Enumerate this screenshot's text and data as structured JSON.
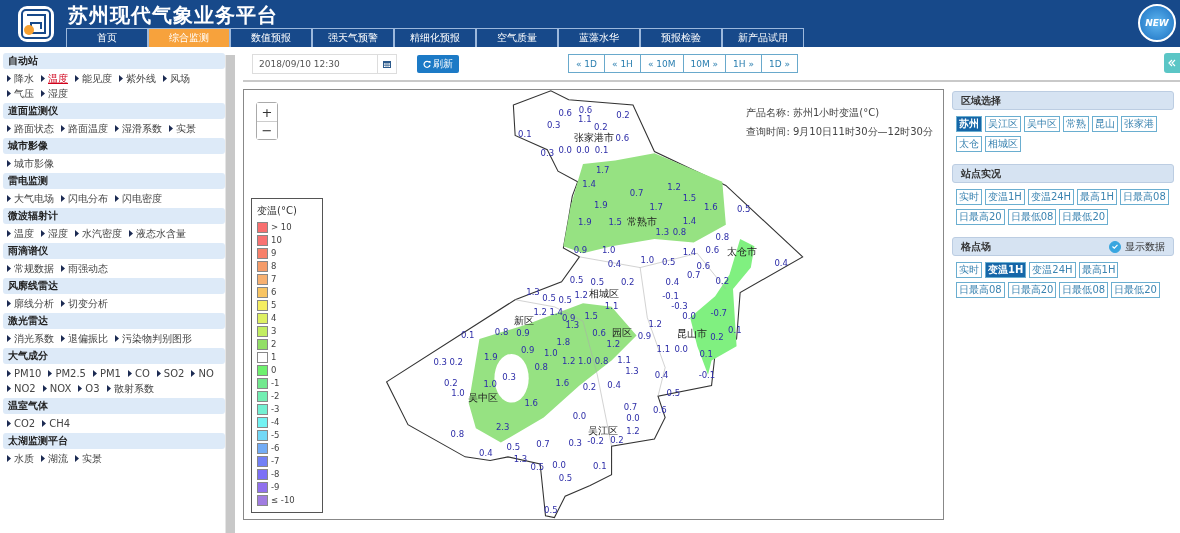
{
  "header": {
    "title": "苏州现代气象业务平台",
    "badge": "NEW"
  },
  "nav": [
    {
      "label": "首页",
      "selected": false
    },
    {
      "label": "综合监测",
      "selected": true
    },
    {
      "label": "数值预报",
      "selected": false
    },
    {
      "label": "强天气预警",
      "selected": false
    },
    {
      "label": "精细化预报",
      "selected": false
    },
    {
      "label": "空气质量",
      "selected": false
    },
    {
      "label": "蓝藻水华",
      "selected": false
    },
    {
      "label": "预报检验",
      "selected": false
    },
    {
      "label": "新产品试用",
      "selected": false
    }
  ],
  "sidebar": [
    {
      "title": "自动站",
      "items": [
        {
          "label": "降水",
          "selected": false
        },
        {
          "label": "温度",
          "selected": true
        },
        {
          "label": "能见度",
          "selected": false
        },
        {
          "label": "紫外线",
          "selected": false
        },
        {
          "label": "风场",
          "selected": false
        },
        {
          "label": "气压",
          "selected": false
        },
        {
          "label": "湿度",
          "selected": false
        }
      ]
    },
    {
      "title": "道面监测仪",
      "items": [
        {
          "label": "路面状态",
          "selected": false
        },
        {
          "label": "路面温度",
          "selected": false
        },
        {
          "label": "湿滑系数",
          "selected": false
        },
        {
          "label": "实景",
          "selected": false
        }
      ]
    },
    {
      "title": "城市影像",
      "items": [
        {
          "label": "城市影像",
          "selected": false
        }
      ]
    },
    {
      "title": "雷电监测",
      "items": [
        {
          "label": "大气电场",
          "selected": false
        },
        {
          "label": "闪电分布",
          "selected": false
        },
        {
          "label": "闪电密度",
          "selected": false
        }
      ]
    },
    {
      "title": "微波辐射计",
      "items": [
        {
          "label": "温度",
          "selected": false
        },
        {
          "label": "湿度",
          "selected": false
        },
        {
          "label": "水汽密度",
          "selected": false
        },
        {
          "label": "液态水含量",
          "selected": false
        }
      ]
    },
    {
      "title": "雨滴谱仪",
      "items": [
        {
          "label": "常规数据",
          "selected": false
        },
        {
          "label": "雨强动态",
          "selected": false
        }
      ]
    },
    {
      "title": "风廓线雷达",
      "items": [
        {
          "label": "廓线分析",
          "selected": false
        },
        {
          "label": "切变分析",
          "selected": false
        }
      ]
    },
    {
      "title": "激光雷达",
      "items": [
        {
          "label": "消光系数",
          "selected": false
        },
        {
          "label": "退偏振比",
          "selected": false
        },
        {
          "label": "污染物判别图形",
          "selected": false
        }
      ]
    },
    {
      "title": "大气成分",
      "items": [
        {
          "label": "PM10",
          "selected": false
        },
        {
          "label": "PM2.5",
          "selected": false
        },
        {
          "label": "PM1",
          "selected": false
        },
        {
          "label": "CO",
          "selected": false
        },
        {
          "label": "SO2",
          "selected": false
        },
        {
          "label": "NO",
          "selected": false
        },
        {
          "label": "NO2",
          "selected": false
        },
        {
          "label": "NOX",
          "selected": false
        },
        {
          "label": "O3",
          "selected": false
        },
        {
          "label": "散射系数",
          "selected": false
        }
      ]
    },
    {
      "title": "温室气体",
      "items": [
        {
          "label": "CO2",
          "selected": false
        },
        {
          "label": "CH4",
          "selected": false
        }
      ]
    },
    {
      "title": "太湖监测平台",
      "items": [
        {
          "label": "水质",
          "selected": false
        },
        {
          "label": "湖流",
          "selected": false
        },
        {
          "label": "实景",
          "selected": false
        }
      ]
    }
  ],
  "toolbar": {
    "datetime": "2018/09/10 12:30",
    "refresh": "刷新",
    "steps": [
      "« 1D",
      "« 1H",
      "« 10M",
      "10M »",
      "1H »",
      "1D »"
    ]
  },
  "map": {
    "product": "产品名称: 苏州1小时变温(°C)",
    "query_time": "查询时间: 9月10日11时30分—12时30分",
    "zoom_in": "+",
    "zoom_out": "−",
    "legend": {
      "title": "变温(°C)",
      "items": [
        {
          "label": "> 10",
          "color": "#f86f6f"
        },
        {
          "label": "10",
          "color": "#f87272"
        },
        {
          "label": "9",
          "color": "#f8806a"
        },
        {
          "label": "8",
          "color": "#f59c6a"
        },
        {
          "label": "7",
          "color": "#f7b070"
        },
        {
          "label": "6",
          "color": "#f8c462"
        },
        {
          "label": "5",
          "color": "#f5ee62"
        },
        {
          "label": "4",
          "color": "#def062"
        },
        {
          "label": "3",
          "color": "#c2ee62"
        },
        {
          "label": "2",
          "color": "#92de66"
        },
        {
          "label": "1",
          "color": "#ffffff"
        },
        {
          "label": "0",
          "color": "#6ef06e"
        },
        {
          "label": "-1",
          "color": "#72e88e"
        },
        {
          "label": "-2",
          "color": "#72eeb2"
        },
        {
          "label": "-3",
          "color": "#72f0d2"
        },
        {
          "label": "-4",
          "color": "#72f2f2"
        },
        {
          "label": "-5",
          "color": "#72d8f6"
        },
        {
          "label": "-6",
          "color": "#72acf6"
        },
        {
          "label": "-7",
          "color": "#7280f6"
        },
        {
          "label": "-8",
          "color": "#7c70f6"
        },
        {
          "label": "-9",
          "color": "#9070ee"
        },
        {
          "label": "≤ -10",
          "color": "#a07ce0"
        }
      ]
    },
    "labels": [
      {
        "text": "0.6",
        "kind": "value"
      },
      {
        "text": "0.6",
        "kind": "value"
      },
      {
        "text": "0.2",
        "kind": "value"
      },
      {
        "text": "0.3",
        "kind": "value"
      },
      {
        "text": "1.1",
        "kind": "value"
      },
      {
        "text": "0.2",
        "kind": "value"
      },
      {
        "text": "0.1",
        "kind": "value"
      },
      {
        "text": "张家港市",
        "kind": "place"
      },
      {
        "text": "0.6",
        "kind": "value"
      },
      {
        "text": "0.3",
        "kind": "value"
      },
      {
        "text": "0.0",
        "kind": "value"
      },
      {
        "text": "0.0",
        "kind": "value"
      },
      {
        "text": "0.1",
        "kind": "value"
      },
      {
        "text": "1.7",
        "kind": "value"
      },
      {
        "text": "1.4",
        "kind": "value"
      },
      {
        "text": "0.7",
        "kind": "value"
      },
      {
        "text": "1.2",
        "kind": "value"
      },
      {
        "text": "1.5",
        "kind": "value"
      },
      {
        "text": "1.9",
        "kind": "value"
      },
      {
        "text": "1.7",
        "kind": "value"
      },
      {
        "text": "1.6",
        "kind": "value"
      },
      {
        "text": "0.5",
        "kind": "value"
      },
      {
        "text": "1.9",
        "kind": "value"
      },
      {
        "text": "1.5",
        "kind": "value"
      },
      {
        "text": "常熟市",
        "kind": "place"
      },
      {
        "text": "1.4",
        "kind": "value"
      },
      {
        "text": "1.3",
        "kind": "value"
      },
      {
        "text": "0.8",
        "kind": "value"
      },
      {
        "text": "0.8",
        "kind": "value"
      },
      {
        "text": "0.9",
        "kind": "value"
      },
      {
        "text": "1.0",
        "kind": "value"
      },
      {
        "text": "1.4",
        "kind": "value"
      },
      {
        "text": "0.6",
        "kind": "value"
      },
      {
        "text": "太仓市",
        "kind": "place"
      },
      {
        "text": "0.4",
        "kind": "value"
      },
      {
        "text": "1.0",
        "kind": "value"
      },
      {
        "text": "0.5",
        "kind": "value"
      },
      {
        "text": "0.6",
        "kind": "value"
      },
      {
        "text": "0.4",
        "kind": "value"
      },
      {
        "text": "0.5",
        "kind": "value"
      },
      {
        "text": "0.5",
        "kind": "value"
      },
      {
        "text": "0.2",
        "kind": "value"
      },
      {
        "text": "0.4",
        "kind": "value"
      },
      {
        "text": "0.7",
        "kind": "value"
      },
      {
        "text": "0.2",
        "kind": "value"
      },
      {
        "text": "1.3",
        "kind": "value"
      },
      {
        "text": "0.5",
        "kind": "value"
      },
      {
        "text": "0.5",
        "kind": "value"
      },
      {
        "text": "1.2",
        "kind": "value"
      },
      {
        "text": "相城区",
        "kind": "place"
      },
      {
        "text": "-0.1",
        "kind": "value"
      },
      {
        "text": "1.1",
        "kind": "value"
      },
      {
        "text": "-0.3",
        "kind": "value"
      },
      {
        "text": "1.2",
        "kind": "value"
      },
      {
        "text": "1.4",
        "kind": "value"
      },
      {
        "text": "0.9",
        "kind": "value"
      },
      {
        "text": "1.5",
        "kind": "value"
      },
      {
        "text": "0.0",
        "kind": "value"
      },
      {
        "text": "-0.7",
        "kind": "value"
      },
      {
        "text": "新区",
        "kind": "place"
      },
      {
        "text": "1.3",
        "kind": "value"
      },
      {
        "text": "1.2",
        "kind": "value"
      },
      {
        "text": "0.1",
        "kind": "value"
      },
      {
        "text": "0.8",
        "kind": "value"
      },
      {
        "text": "0.9",
        "kind": "value"
      },
      {
        "text": "0.6",
        "kind": "value"
      },
      {
        "text": "园区",
        "kind": "place"
      },
      {
        "text": "0.9",
        "kind": "value"
      },
      {
        "text": "昆山市",
        "kind": "place"
      },
      {
        "text": "0.2",
        "kind": "value"
      },
      {
        "text": "0.1",
        "kind": "value"
      },
      {
        "text": "1.8",
        "kind": "value"
      },
      {
        "text": "1.2",
        "kind": "value"
      },
      {
        "text": "0.9",
        "kind": "value"
      },
      {
        "text": "1.0",
        "kind": "value"
      },
      {
        "text": "1.1",
        "kind": "value"
      },
      {
        "text": "0.0",
        "kind": "value"
      },
      {
        "text": "0.1",
        "kind": "value"
      },
      {
        "text": "0.3",
        "kind": "value"
      },
      {
        "text": "0.2",
        "kind": "value"
      },
      {
        "text": "1.9",
        "kind": "value"
      },
      {
        "text": "1.2",
        "kind": "value"
      },
      {
        "text": "1.0",
        "kind": "value"
      },
      {
        "text": "0.8",
        "kind": "value"
      },
      {
        "text": "1.1",
        "kind": "value"
      },
      {
        "text": "0.3",
        "kind": "value"
      },
      {
        "text": "0.8",
        "kind": "value"
      },
      {
        "text": "1.3",
        "kind": "value"
      },
      {
        "text": "0.4",
        "kind": "value"
      },
      {
        "text": "-0.1",
        "kind": "value"
      },
      {
        "text": "0.2",
        "kind": "value"
      },
      {
        "text": "1.0",
        "kind": "value"
      },
      {
        "text": "1.6",
        "kind": "value"
      },
      {
        "text": "0.2",
        "kind": "value"
      },
      {
        "text": "0.4",
        "kind": "value"
      },
      {
        "text": "1.0",
        "kind": "value"
      },
      {
        "text": "吴中区",
        "kind": "place"
      },
      {
        "text": "0.5",
        "kind": "value"
      },
      {
        "text": "1.6",
        "kind": "value"
      },
      {
        "text": "0.7",
        "kind": "value"
      },
      {
        "text": "0.6",
        "kind": "value"
      },
      {
        "text": "0.0",
        "kind": "value"
      },
      {
        "text": "0.0",
        "kind": "value"
      },
      {
        "text": "0.8",
        "kind": "value"
      },
      {
        "text": "2.3",
        "kind": "value"
      },
      {
        "text": "吴江区",
        "kind": "place"
      },
      {
        "text": "1.2",
        "kind": "value"
      },
      {
        "text": "0.4",
        "kind": "value"
      },
      {
        "text": "0.5",
        "kind": "value"
      },
      {
        "text": "0.7",
        "kind": "value"
      },
      {
        "text": "0.3",
        "kind": "value"
      },
      {
        "text": "-0.2",
        "kind": "value"
      },
      {
        "text": "0.2",
        "kind": "value"
      },
      {
        "text": "1.3",
        "kind": "value"
      },
      {
        "text": "0.5",
        "kind": "value"
      },
      {
        "text": "0.0",
        "kind": "value"
      },
      {
        "text": "0.1",
        "kind": "value"
      },
      {
        "text": "0.5",
        "kind": "value"
      },
      {
        "text": "0.5",
        "kind": "value"
      }
    ]
  },
  "right": [
    {
      "title": "区域选择",
      "buttons": [
        {
          "label": "苏州",
          "selected": true
        },
        {
          "label": "吴江区",
          "selected": false
        },
        {
          "label": "吴中区",
          "selected": false
        },
        {
          "label": "常熟",
          "selected": false
        },
        {
          "label": "昆山",
          "selected": false
        },
        {
          "label": "张家港",
          "selected": false
        },
        {
          "label": "太仓",
          "selected": false
        },
        {
          "label": "相城区",
          "selected": false
        }
      ]
    },
    {
      "title": "站点实况",
      "buttons": [
        {
          "label": "实时",
          "selected": false
        },
        {
          "label": "变温1H",
          "selected": false
        },
        {
          "label": "变温24H",
          "selected": false
        },
        {
          "label": "最高1H",
          "selected": false
        },
        {
          "label": "日最高08",
          "selected": false
        },
        {
          "label": "日最高20",
          "selected": false
        },
        {
          "label": "日最低08",
          "selected": false
        },
        {
          "label": "日最低20",
          "selected": false
        }
      ]
    },
    {
      "title": "格点场",
      "toggle": {
        "label": "显示数据",
        "checked": true
      },
      "buttons": [
        {
          "label": "实时",
          "selected": false
        },
        {
          "label": "变温1H",
          "selected": true
        },
        {
          "label": "变温24H",
          "selected": false
        },
        {
          "label": "最高1H",
          "selected": false
        },
        {
          "label": "日最高08",
          "selected": false
        },
        {
          "label": "日最高20",
          "selected": false
        },
        {
          "label": "日最低08",
          "selected": false
        },
        {
          "label": "日最低20",
          "selected": false
        }
      ]
    }
  ]
}
